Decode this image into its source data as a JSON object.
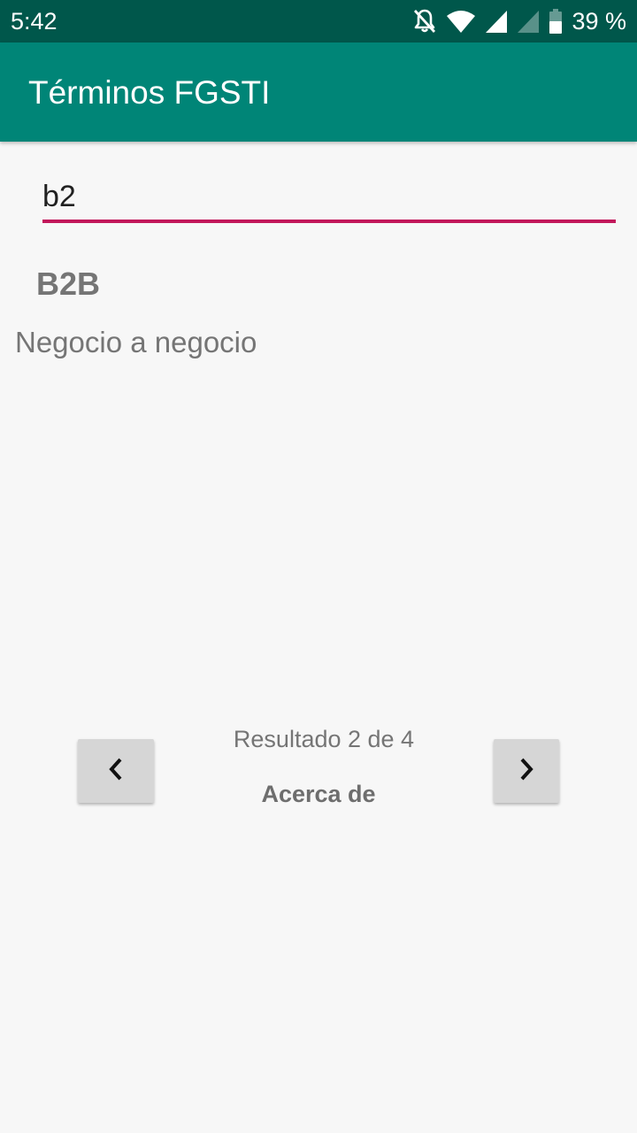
{
  "status_bar": {
    "time": "5:42",
    "battery_percent": "39 %",
    "icons": [
      "notifications-off-icon",
      "wifi-icon",
      "signal-icon",
      "signal-weak-icon",
      "battery-icon"
    ]
  },
  "app_bar": {
    "title": "Términos FGSTI",
    "color": "#008577",
    "status_color": "#00574b"
  },
  "search": {
    "value": "b2",
    "accent_color": "#c2185b"
  },
  "result": {
    "term": "B2B",
    "definition": "Negocio a negocio"
  },
  "navigation": {
    "prev_icon": "chevron-left-icon",
    "next_icon": "chevron-right-icon",
    "counter": "Resultado 2 de 4",
    "about_label": "Acerca de"
  }
}
